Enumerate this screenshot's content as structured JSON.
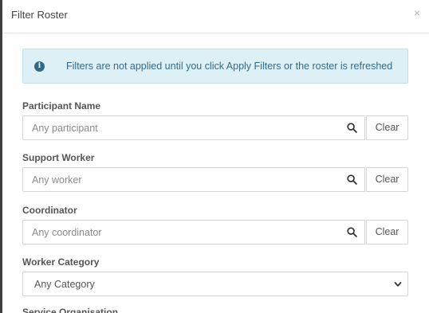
{
  "modal": {
    "title": "Filter Roster",
    "close_label": "×"
  },
  "alert": {
    "icon": "info-circle-icon",
    "text": "Filters are not applied until you click Apply Filters or the roster is refreshed"
  },
  "fields": [
    {
      "label": "Participant Name",
      "placeholder": "Any participant",
      "clear_label": "Clear"
    },
    {
      "label": "Support Worker",
      "placeholder": "Any worker",
      "clear_label": "Clear"
    },
    {
      "label": "Coordinator",
      "placeholder": "Any coordinator",
      "clear_label": "Clear"
    }
  ],
  "worker_category": {
    "label": "Worker Category",
    "selected": "Any Category"
  },
  "next_section_label": "Service Organisation",
  "colors": {
    "alert_bg": "#dcf0f6",
    "alert_text": "#346b87",
    "border": "#d5d5d5"
  }
}
